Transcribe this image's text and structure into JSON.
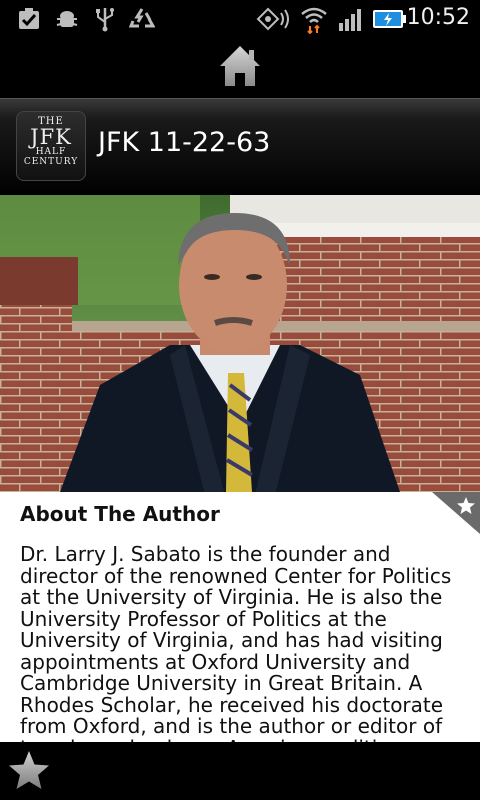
{
  "status_bar": {
    "time": "10:52",
    "icons": [
      "checkbox-icon",
      "android-debug-icon",
      "usb-icon",
      "recycle-icon",
      "gps-icon",
      "wifi-icon",
      "signal-icon",
      "battery-charging-icon"
    ]
  },
  "header": {
    "title": "JFK 11-22-63"
  },
  "logo": {
    "line1": "THE",
    "line2": "JFK",
    "line3": "HALF",
    "line4": "CENTURY"
  },
  "article": {
    "heading": "About The Author",
    "body": "Dr. Larry J. Sabato is the founder and director of the renowned Center for Politics at the University of Virginia. He is also the University Professor of Politics at the University of Virginia, and has had visiting appointments at Oxford University and Cambridge University in Great Britain. A Rhodes Scholar, he received his doctorate from Oxford, and is the author or editor of two dozen books on American politics, including The Rise of"
  }
}
